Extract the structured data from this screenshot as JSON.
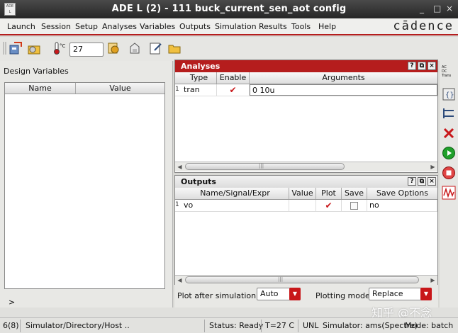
{
  "window": {
    "title": "ADE L (2) - 111 buck_current_sen_aot config",
    "minimize": "_",
    "maximize": "□",
    "close": "×"
  },
  "menu": {
    "items": [
      "Launch",
      "Session",
      "Setup",
      "Analyses",
      "Variables",
      "Outputs",
      "Simulation",
      "Results",
      "Tools",
      "Help"
    ],
    "brand": "cādence"
  },
  "toolbar": {
    "temperature_value": "27",
    "temp_icon_label": "°C"
  },
  "design_variables": {
    "title": "Design Variables",
    "columns": [
      "Name",
      "Value"
    ],
    "expand_arrow": ">"
  },
  "analyses": {
    "title": "Analyses",
    "columns": [
      "Type",
      "Enable",
      "Arguments"
    ],
    "rows": [
      {
        "num": "1",
        "type": "tran",
        "enabled": true,
        "arguments": "0 10u"
      }
    ],
    "scroll_grip": "|||"
  },
  "outputs": {
    "title": "Outputs",
    "columns": [
      "Name/Signal/Expr",
      "Value",
      "Plot",
      "Save",
      "Save Options"
    ],
    "rows": [
      {
        "num": "1",
        "name": "vo",
        "value": "",
        "plot": true,
        "save": false,
        "save_options": "no"
      }
    ],
    "scroll_grip": "|||"
  },
  "bottom": {
    "plot_after_label": "Plot after simulation:",
    "plot_after_value": "Auto",
    "plotting_mode_label": "Plotting mode:",
    "plotting_mode_value": "Replace"
  },
  "right_toolbar": {
    "ac_dc_trans": [
      "AC",
      "DC",
      "Trans"
    ]
  },
  "status": {
    "count": "6(8)",
    "path": "Simulator/Directory/Host ..",
    "state": "Status: Ready",
    "temp": "T=27  C",
    "unl": "UNL",
    "simulator": "Simulator: ams(Spectre)",
    "mode": "Mode: batch"
  },
  "watermark": "知乎 @不念",
  "colors": {
    "accent": "#c8171a",
    "dock_title": "#b51d1d"
  }
}
